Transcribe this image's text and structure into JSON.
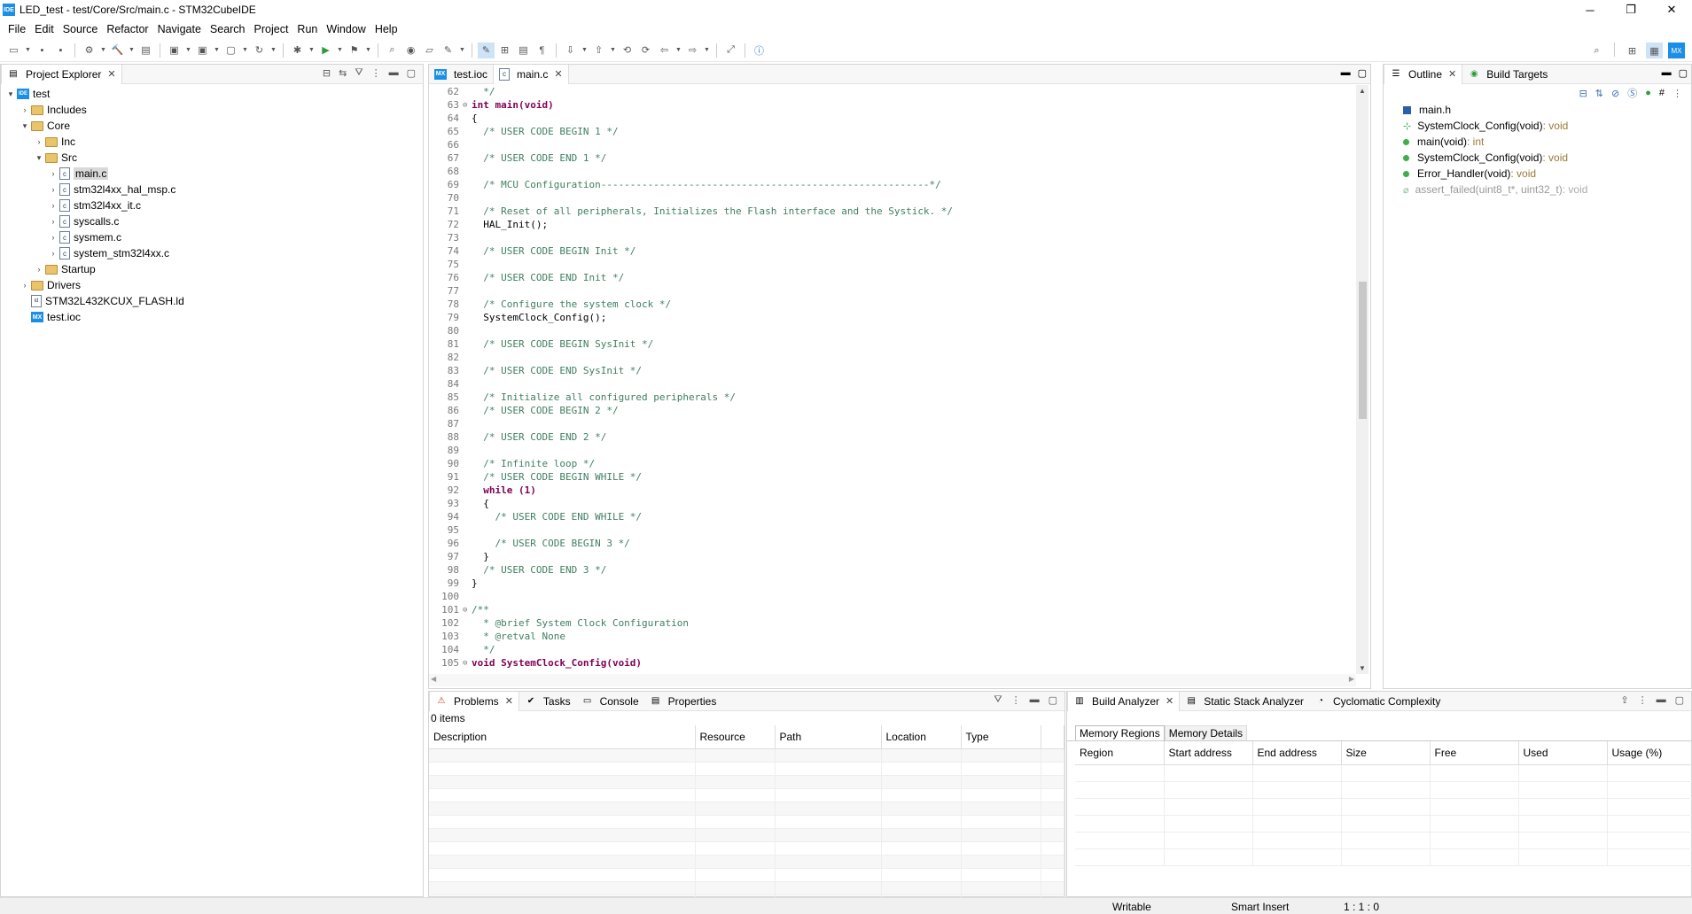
{
  "window": {
    "title": "LED_test - test/Core/Src/main.c - STM32CubeIDE",
    "app_icon": "IDE",
    "controls": [
      "─",
      "❐",
      "✕"
    ]
  },
  "menu": [
    "File",
    "Edit",
    "Source",
    "Refactor",
    "Navigate",
    "Search",
    "Project",
    "Run",
    "Window",
    "Help"
  ],
  "project_explorer": {
    "title": "Project Explorer",
    "items": [
      {
        "label": "test",
        "type": "project",
        "arrow": "▾"
      },
      {
        "label": "Includes",
        "type": "includes",
        "arrow": "›"
      },
      {
        "label": "Core",
        "type": "folder",
        "arrow": "▾"
      },
      {
        "label": "Inc",
        "type": "folder",
        "arrow": "›"
      },
      {
        "label": "Src",
        "type": "folder",
        "arrow": "▾"
      },
      {
        "label": "main.c",
        "type": "cfile",
        "arrow": "›",
        "selected": true
      },
      {
        "label": "stm32l4xx_hal_msp.c",
        "type": "cfile",
        "arrow": "›"
      },
      {
        "label": "stm32l4xx_it.c",
        "type": "cfile",
        "arrow": "›"
      },
      {
        "label": "syscalls.c",
        "type": "cfile",
        "arrow": "›"
      },
      {
        "label": "sysmem.c",
        "type": "cfile",
        "arrow": "›"
      },
      {
        "label": "system_stm32l4xx.c",
        "type": "cfile",
        "arrow": "›"
      },
      {
        "label": "Startup",
        "type": "folder",
        "arrow": "›"
      },
      {
        "label": "Drivers",
        "type": "folder",
        "arrow": "›"
      },
      {
        "label": "STM32L432KCUX_FLASH.ld",
        "type": "ld",
        "arrow": ""
      },
      {
        "label": "test.ioc",
        "type": "mx",
        "arrow": ""
      }
    ]
  },
  "editor": {
    "tabs": [
      {
        "label": "test.ioc",
        "icon": "MX"
      },
      {
        "label": "main.c",
        "icon": "c"
      }
    ],
    "lines": [
      {
        "n": "62",
        "fold": "",
        "code": "  */",
        "cls": "cm"
      },
      {
        "n": "63",
        "fold": "⊖",
        "code": "int main(void)",
        "cls": "kw"
      },
      {
        "n": "64",
        "fold": "",
        "code": "{",
        "cls": ""
      },
      {
        "n": "65",
        "fold": "",
        "code": "  /* USER CODE BEGIN 1 */",
        "cls": "cm"
      },
      {
        "n": "66",
        "fold": "",
        "code": "",
        "cls": ""
      },
      {
        "n": "67",
        "fold": "",
        "code": "  /* USER CODE END 1 */",
        "cls": "cm"
      },
      {
        "n": "68",
        "fold": "",
        "code": "",
        "cls": ""
      },
      {
        "n": "69",
        "fold": "",
        "code": "  /* MCU Configuration--------------------------------------------------------*/",
        "cls": "cm"
      },
      {
        "n": "70",
        "fold": "",
        "code": "",
        "cls": ""
      },
      {
        "n": "71",
        "fold": "",
        "code": "  /* Reset of all peripherals, Initializes the Flash interface and the Systick. */",
        "cls": "cm"
      },
      {
        "n": "72",
        "fold": "",
        "code": "  HAL_Init();",
        "cls": ""
      },
      {
        "n": "73",
        "fold": "",
        "code": "",
        "cls": ""
      },
      {
        "n": "74",
        "fold": "",
        "code": "  /* USER CODE BEGIN Init */",
        "cls": "cm"
      },
      {
        "n": "75",
        "fold": "",
        "code": "",
        "cls": ""
      },
      {
        "n": "76",
        "fold": "",
        "code": "  /* USER CODE END Init */",
        "cls": "cm"
      },
      {
        "n": "77",
        "fold": "",
        "code": "",
        "cls": ""
      },
      {
        "n": "78",
        "fold": "",
        "code": "  /* Configure the system clock */",
        "cls": "cm"
      },
      {
        "n": "79",
        "fold": "",
        "code": "  SystemClock_Config();",
        "cls": ""
      },
      {
        "n": "80",
        "fold": "",
        "code": "",
        "cls": ""
      },
      {
        "n": "81",
        "fold": "",
        "code": "  /* USER CODE BEGIN SysInit */",
        "cls": "cm"
      },
      {
        "n": "82",
        "fold": "",
        "code": "",
        "cls": ""
      },
      {
        "n": "83",
        "fold": "",
        "code": "  /* USER CODE END SysInit */",
        "cls": "cm"
      },
      {
        "n": "84",
        "fold": "",
        "code": "",
        "cls": ""
      },
      {
        "n": "85",
        "fold": "",
        "code": "  /* Initialize all configured peripherals */",
        "cls": "cm"
      },
      {
        "n": "86",
        "fold": "",
        "code": "  /* USER CODE BEGIN 2 */",
        "cls": "cm"
      },
      {
        "n": "87",
        "fold": "",
        "code": "",
        "cls": ""
      },
      {
        "n": "88",
        "fold": "",
        "code": "  /* USER CODE END 2 */",
        "cls": "cm"
      },
      {
        "n": "89",
        "fold": "",
        "code": "",
        "cls": ""
      },
      {
        "n": "90",
        "fold": "",
        "code": "  /* Infinite loop */",
        "cls": "cm"
      },
      {
        "n": "91",
        "fold": "",
        "code": "  /* USER CODE BEGIN WHILE */",
        "cls": "cm"
      },
      {
        "n": "92",
        "fold": "",
        "code": "  while (1)",
        "cls": "kw"
      },
      {
        "n": "93",
        "fold": "",
        "code": "  {",
        "cls": ""
      },
      {
        "n": "94",
        "fold": "",
        "code": "    /* USER CODE END WHILE */",
        "cls": "cm"
      },
      {
        "n": "95",
        "fold": "",
        "code": "",
        "cls": ""
      },
      {
        "n": "96",
        "fold": "",
        "code": "    /* USER CODE BEGIN 3 */",
        "cls": "cm"
      },
      {
        "n": "97",
        "fold": "",
        "code": "  }",
        "cls": ""
      },
      {
        "n": "98",
        "fold": "",
        "code": "  /* USER CODE END 3 */",
        "cls": "cm"
      },
      {
        "n": "99",
        "fold": "",
        "code": "}",
        "cls": ""
      },
      {
        "n": "100",
        "fold": "",
        "code": "",
        "cls": ""
      },
      {
        "n": "101",
        "fold": "⊖",
        "code": "/**",
        "cls": "cm"
      },
      {
        "n": "102",
        "fold": "",
        "code": "  * @brief System Clock Configuration",
        "cls": "cm"
      },
      {
        "n": "103",
        "fold": "",
        "code": "  * @retval None",
        "cls": "cm"
      },
      {
        "n": "104",
        "fold": "",
        "code": "  */",
        "cls": "cm"
      },
      {
        "n": "105",
        "fold": "⊖",
        "code": "void SystemClock_Config(void)",
        "cls": "kw"
      }
    ]
  },
  "outline": {
    "tabs": [
      "Outline",
      "Build Targets"
    ],
    "items": [
      {
        "name": "main.h",
        "ret": "",
        "icon": "include"
      },
      {
        "name": "SystemClock_Config(void)",
        "ret": " : void",
        "icon": "decl"
      },
      {
        "name": "main(void)",
        "ret": " : int",
        "icon": "func"
      },
      {
        "name": "SystemClock_Config(void)",
        "ret": " : void",
        "icon": "func"
      },
      {
        "name": "Error_Handler(void)",
        "ret": " : void",
        "icon": "func"
      },
      {
        "name": "assert_failed(uint8_t*, uint32_t)",
        "ret": " : void",
        "icon": "inactive"
      }
    ]
  },
  "problems": {
    "tabs": [
      "Problems",
      "Tasks",
      "Console",
      "Properties"
    ],
    "count": "0 items",
    "columns": [
      "Description",
      "Resource",
      "Path",
      "Location",
      "Type"
    ]
  },
  "build_analyzer": {
    "tabs": [
      "Build Analyzer",
      "Static Stack Analyzer",
      "Cyclomatic Complexity"
    ],
    "subtabs": [
      "Memory Regions",
      "Memory Details"
    ],
    "columns": [
      "Region",
      "Start address",
      "End address",
      "Size",
      "Free",
      "Used",
      "Usage (%)"
    ]
  },
  "status": {
    "writable": "Writable",
    "insert": "Smart Insert",
    "position": "1 : 1 : 0"
  }
}
